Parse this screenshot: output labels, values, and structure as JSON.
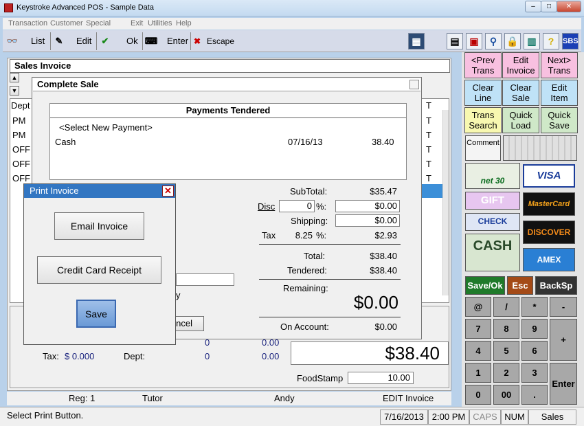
{
  "window": {
    "title": "Keystroke Advanced POS - Sample Data"
  },
  "menu": [
    "Transaction",
    "Customer",
    "Special",
    "Exit",
    "Utilities",
    "Help"
  ],
  "toolbar": {
    "list": "List",
    "edit": "Edit",
    "ok": "Ok",
    "enter": "Enter",
    "escape": "Escape"
  },
  "invoice": {
    "header": "Sales Invoice",
    "dept_col": "Dept",
    "t_col": "T",
    "rows": [
      {
        "dept": "PM",
        "t": "T"
      },
      {
        "dept": "PM",
        "t": "T"
      },
      {
        "dept": "OFF",
        "t": "T"
      },
      {
        "dept": "OFF",
        "t": "T"
      },
      {
        "dept": "OFF",
        "t": "T"
      }
    ]
  },
  "complete_sale": {
    "title": "Complete Sale",
    "payments_header": "Payments Tendered",
    "select_new": "<Select New Payment>",
    "payment": {
      "method": "Cash",
      "date": "07/16/13",
      "amount": "38.40"
    },
    "subtotal_label": "SubTotal:",
    "subtotal": "$35.47",
    "disc_label": "Disc",
    "disc_pct": "0",
    "pct_sign": "%:",
    "disc_amount": "$0.00",
    "shipping_label": "Shipping:",
    "shipping": "$0.00",
    "tax_label": "Tax",
    "tax_rate": "8.25",
    "tax_amount": "$2.93",
    "total_label": "Total:",
    "total": "$38.40",
    "tendered_label": "Tendered:",
    "tendered": "$38.40",
    "remaining_label": "Remaining:",
    "remaining": "$0.00",
    "on_account_label": "On Account:",
    "on_account": "$0.00",
    "cancel_partial": "ncel",
    "y_partial": "y"
  },
  "print_invoice": {
    "title": "Print Invoice",
    "email": "Email Invoice",
    "credit_receipt": "Credit Card Receipt",
    "save": "Save"
  },
  "totals_area": {
    "tax_label": "Tax:",
    "tax_value": "$ 0.000",
    "dept_label": "Dept:",
    "dept_value": "0",
    "dept_amount": "0.00",
    "upper_left": "0",
    "upper_right": "0.00",
    "grand_total": "$38.40",
    "foodstamp_label": "FoodStamp",
    "foodstamp": "10.00"
  },
  "footer_info": {
    "reg": "Reg: 1",
    "tutor": "Tutor",
    "user": "Andy",
    "mode": "EDIT Invoice"
  },
  "right_panel": {
    "row1": [
      "<Prev\nTrans",
      "Edit\nInvoice",
      "Next>\nTrans"
    ],
    "row2": [
      "Clear\nLine",
      "Clear\nSale",
      "Edit\nItem"
    ],
    "row3": [
      "Trans\nSearch",
      "Quick\nLoad",
      "Quick\nSave"
    ],
    "comment": "Comment",
    "payments": {
      "net30": "net 30",
      "visa": "VISA",
      "gift": "GIFT",
      "mastercard": "MasterCard",
      "check": "CHECK",
      "discover": "DISCOVER",
      "cash": "CASH",
      "amex": "AMEX"
    },
    "save_ok": "Save/Ok",
    "esc": "Esc",
    "backsp": "BackSp",
    "keys": [
      "@",
      "/",
      "*",
      "-",
      "7",
      "8",
      "9",
      "+",
      "4",
      "5",
      "6",
      "1",
      "2",
      "3",
      "Enter",
      "0",
      "00",
      "."
    ]
  },
  "status": {
    "message": "Select Print Button.",
    "date": "7/16/2013",
    "time": "2:00 PM",
    "caps": "CAPS",
    "num": "NUM",
    "mode": "Sales"
  },
  "colors": {
    "yellow": "#f8f8b0",
    "pink": "#f8c0e0",
    "blue": "#bfe2f7",
    "green": "#cfe8c8",
    "save_ok": "#1f7a2a",
    "esc": "#a44a17",
    "backsp": "#333333",
    "highlight": "#3c8fd8"
  }
}
